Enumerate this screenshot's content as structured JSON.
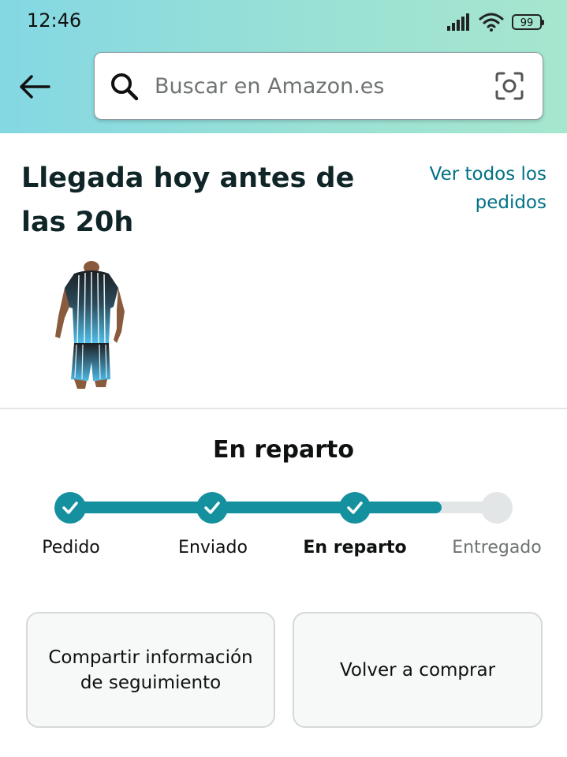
{
  "status_bar": {
    "time": "12:46",
    "battery": "99"
  },
  "search": {
    "placeholder": "Buscar en Amazon.es",
    "value": ""
  },
  "delivery": {
    "title": "Llegada hoy antes de las 20h",
    "view_all_orders": "Ver todos los pedidos"
  },
  "product": {
    "image_icon": "sports-outfit-image"
  },
  "tracking": {
    "status": "En reparto",
    "progress": 0.87,
    "steps": [
      {
        "label": "Pedido",
        "state": "done"
      },
      {
        "label": "Enviado",
        "state": "done"
      },
      {
        "label": "En reparto",
        "state": "current"
      },
      {
        "label": "Entregado",
        "state": "pending"
      }
    ]
  },
  "actions": {
    "share_tracking": "Compartir información de seguimiento",
    "buy_again": "Volver a comprar"
  },
  "colors": {
    "accent": "#15909f",
    "link": "#007185",
    "track_empty": "#e3e6e6"
  }
}
